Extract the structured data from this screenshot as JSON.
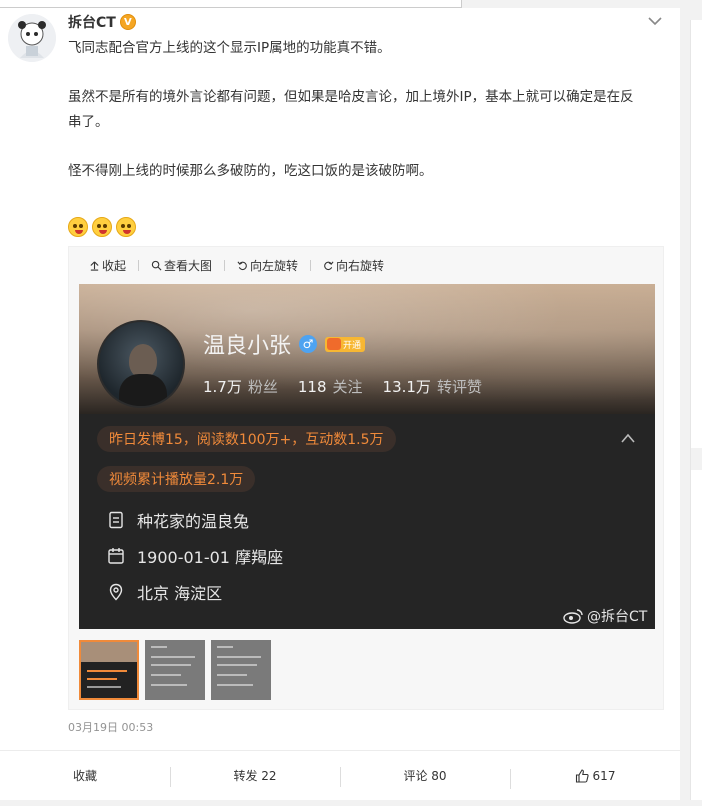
{
  "author": {
    "name": "拆台CT",
    "verified_badge": "V"
  },
  "post": {
    "lines": [
      "飞同志配合官方上线的这个显示IP属地的功能真不错。",
      "虽然不是所有的境外言论都有问题，但如果是哈皮言论，加上境外IP，基本上就可以确定是在反",
      "串了。",
      "怪不得刚上线的时候那么多破防的，吃这口饭的是该破防啊。"
    ]
  },
  "media_toolbar": {
    "collapse": "收起",
    "view_large": "查看大图",
    "rotate_left": "向左旋转",
    "rotate_right": "向右旋转"
  },
  "profile_card": {
    "name": "温良小张",
    "vip_label": "开通",
    "stats": [
      {
        "num": "1.7万",
        "label": "粉丝"
      },
      {
        "num": "118",
        "label": "关注"
      },
      {
        "num": "13.1万",
        "label": "转评赞"
      }
    ],
    "pill_yesterday": "昨日发博15，阅读数100万+，互动数1.5万",
    "pill_video": "视频累计播放量2.1万",
    "info": [
      "种花家的温良兔",
      "1900-01-01 摩羯座",
      "北京 海淀区"
    ],
    "watermark": "@拆台CT"
  },
  "timestamp": "03月19日 00:53",
  "actions": {
    "favorite": "收藏",
    "repost": "转发 22",
    "comment": "评论 80",
    "like": "617"
  },
  "colors": {
    "accent_orange": "#f08a3a",
    "verified": "#f5a623",
    "gender_male": "#4ea3f1"
  }
}
